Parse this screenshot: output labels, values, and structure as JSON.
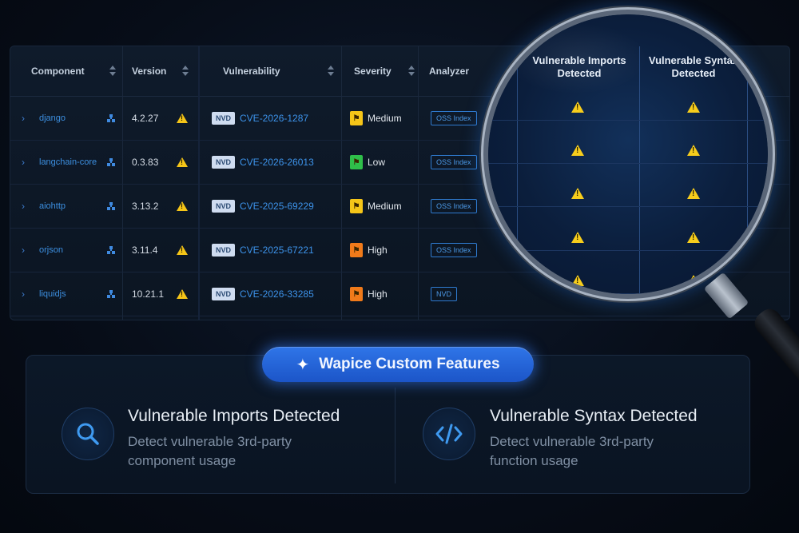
{
  "table": {
    "headers": {
      "component": "Component",
      "version": "Version",
      "vulnerability": "Vulnerability",
      "severity": "Severity",
      "analyzer": "Analyzer"
    },
    "rows": [
      {
        "component": "django",
        "version": "4.2.27",
        "source": "NVD",
        "cve": "CVE-2026-1287",
        "severity": "Medium",
        "analyzer": "OSS Index"
      },
      {
        "component": "langchain-core",
        "version": "0.3.83",
        "source": "NVD",
        "cve": "CVE-2026-26013",
        "severity": "Low",
        "analyzer": "OSS Index"
      },
      {
        "component": "aiohttp",
        "version": "3.13.2",
        "source": "NVD",
        "cve": "CVE-2025-69229",
        "severity": "Medium",
        "analyzer": "OSS Index"
      },
      {
        "component": "orjson",
        "version": "3.11.4",
        "source": "NVD",
        "cve": "CVE-2025-67221",
        "severity": "High",
        "analyzer": "OSS Index"
      },
      {
        "component": "liquidjs",
        "version": "10.21.1",
        "source": "NVD",
        "cve": "CVE-2026-33285",
        "severity": "High",
        "analyzer": "NVD"
      }
    ]
  },
  "magnifier": {
    "header_left": "Vulnerable Imports Detected",
    "header_right": "Vulnerable Syntax Detected"
  },
  "features": {
    "badge": "Wapice Custom Features",
    "items": [
      {
        "title": "Vulnerable Imports Detected",
        "desc": "Detect vulnerable 3rd-party component usage",
        "icon": "search-icon"
      },
      {
        "title": "Vulnerable Syntax Detected",
        "desc": "Detect vulnerable 3rd-party function usage",
        "icon": "code-icon"
      }
    ]
  },
  "colors": {
    "accent": "#2f75e8",
    "medium": "#f5c518",
    "low": "#2fbf4a",
    "high": "#f07a1a",
    "warning": "#f5c518"
  }
}
